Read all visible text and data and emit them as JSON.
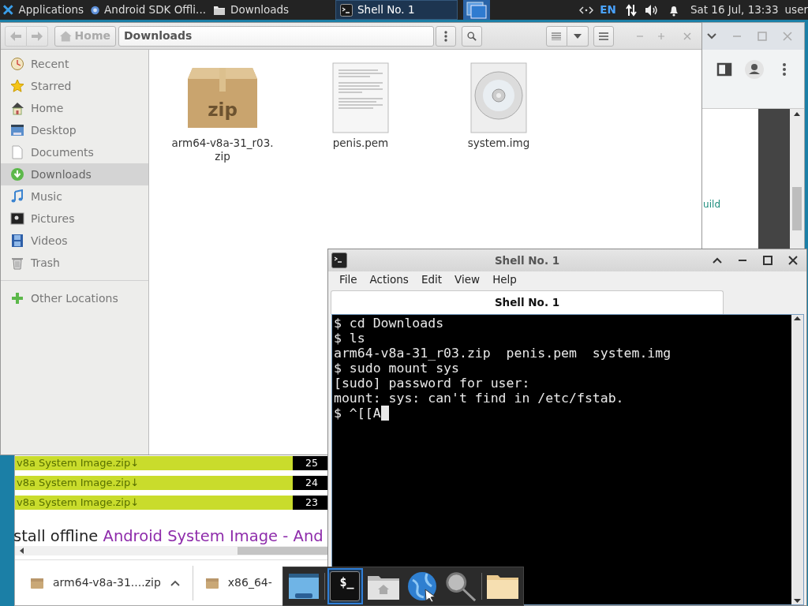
{
  "panel": {
    "apps_label": "Applications",
    "tasks": [
      {
        "kind": "browser",
        "title": "Android SDK Offli...",
        "selected": false
      },
      {
        "kind": "folder",
        "title": "Downloads",
        "selected": false
      },
      {
        "kind": "terminal",
        "title": "Shell No. 1",
        "selected": true
      }
    ],
    "keyboard_layout": "EN",
    "clock": "Sat 16 Jul, 13:33",
    "user": "user"
  },
  "browser": {
    "page_snippet": "uild",
    "file_rows": [
      {
        "label": "v8a System Image.zip↓",
        "count": "25"
      },
      {
        "label": "v8a System Image.zip↓",
        "count": "24"
      },
      {
        "label": "v8a System Image.zip↓",
        "count": "23"
      }
    ],
    "heading": {
      "text": "stall offline ",
      "link": "Android System Image - And"
    },
    "downloads": [
      {
        "name": "arm64-v8a-31....zip",
        "chevron": true
      },
      {
        "name": "x86_64-",
        "chevron": false
      }
    ]
  },
  "file_manager": {
    "back_disabled": true,
    "forward_disabled": true,
    "path": [
      {
        "label": "Home",
        "selected": false
      },
      {
        "label": "Downloads",
        "selected": true
      }
    ],
    "sidebar": [
      {
        "kind": "recent",
        "label": "Recent",
        "selected": false
      },
      {
        "kind": "starred",
        "label": "Starred",
        "selected": false
      },
      {
        "kind": "home",
        "label": "Home",
        "selected": false
      },
      {
        "kind": "desktop",
        "label": "Desktop",
        "selected": false
      },
      {
        "kind": "documents",
        "label": "Documents",
        "selected": false
      },
      {
        "kind": "downloads",
        "label": "Downloads",
        "selected": true
      },
      {
        "kind": "music",
        "label": "Music",
        "selected": false
      },
      {
        "kind": "pictures",
        "label": "Pictures",
        "selected": false
      },
      {
        "kind": "videos",
        "label": "Videos",
        "selected": false
      },
      {
        "kind": "trash",
        "label": "Trash",
        "selected": false
      }
    ],
    "other_locations": "Other Locations",
    "files": [
      {
        "kind": "archive",
        "name": "arm64-v8a-31_r03.\nzip",
        "icon_label": "zip"
      },
      {
        "kind": "text",
        "name": "penis.pem"
      },
      {
        "kind": "disc",
        "name": "system.img"
      }
    ]
  },
  "terminal": {
    "title": "Shell No. 1",
    "menu": [
      "File",
      "Actions",
      "Edit",
      "View",
      "Help"
    ],
    "tabs": [
      {
        "label": "Shell No. 1",
        "selected": true
      }
    ],
    "lines": [
      {
        "text": "$ cd Downloads",
        "cursor": false
      },
      {
        "text": "$ ls",
        "cursor": false
      },
      {
        "text": "arm64-v8a-31_r03.zip  penis.pem  system.img",
        "cursor": false
      },
      {
        "text": "$ sudo mount sys",
        "cursor": false
      },
      {
        "text": "[sudo] password for user:",
        "cursor": false
      },
      {
        "text": "mount: sys: can't find in /etc/fstab.",
        "cursor": false
      },
      {
        "text": "$ ^[[A",
        "cursor": true
      }
    ]
  },
  "dock": [
    {
      "kind": "desktop",
      "selected": false
    },
    {
      "kind": "terminal",
      "glyph": "$_",
      "selected": true
    },
    {
      "kind": "home",
      "selected": false
    },
    {
      "kind": "globe",
      "selected": false
    },
    {
      "kind": "search",
      "selected": false
    },
    {
      "kind": "folder",
      "selected": false
    }
  ]
}
